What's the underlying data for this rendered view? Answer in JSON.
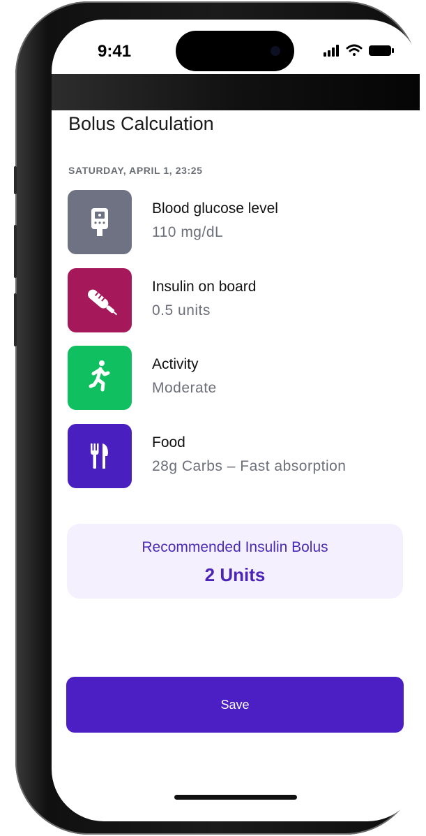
{
  "status_bar": {
    "time": "9:41"
  },
  "page": {
    "title": "Bolus Calculation",
    "date": "SATURDAY, APRIL 1, 23:25"
  },
  "items": [
    {
      "label": "Blood glucose level",
      "value": "110 mg/dL",
      "icon": "glucometer-icon",
      "color": "#6e7282"
    },
    {
      "label": "Insulin on board",
      "value": "0.5 units",
      "icon": "syringe-icon",
      "color": "#a5195a"
    },
    {
      "label": "Activity",
      "value": "Moderate",
      "icon": "running-icon",
      "color": "#10c060"
    },
    {
      "label": "Food",
      "value": "28g Carbs – Fast absorption",
      "icon": "fork-knife-icon",
      "color": "#4a1fc0"
    }
  ],
  "recommendation": {
    "title": "Recommended Insulin Bolus",
    "value": "2 Units"
  },
  "actions": {
    "save_label": "Save"
  },
  "colors": {
    "accent": "#4b1fc4",
    "rec_bg": "#f5f0fe"
  }
}
